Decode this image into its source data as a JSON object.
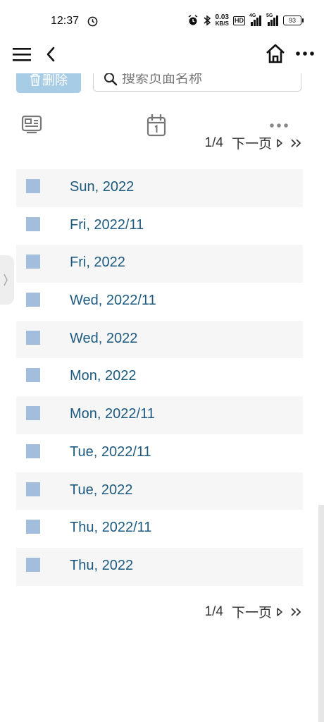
{
  "status_bar": {
    "time": "12:37",
    "net_speed_value": "0.03",
    "net_speed_unit": "KB/S",
    "hd_badge": "HD",
    "signal_1": "4G",
    "signal_2": "5G",
    "battery": "93"
  },
  "toolbar": {
    "delete_label": "删除",
    "search_placeholder": "搜索页面名称"
  },
  "pager_top": {
    "page": "1/4",
    "next_label": "下一页"
  },
  "pager_bottom": {
    "page": "1/4",
    "next_label": "下一页"
  },
  "pages": [
    {
      "label": "Sun, 2022"
    },
    {
      "label": "Fri, 2022/11"
    },
    {
      "label": "Fri, 2022"
    },
    {
      "label": "Wed, 2022/11"
    },
    {
      "label": "Wed, 2022"
    },
    {
      "label": "Mon, 2022"
    },
    {
      "label": "Mon, 2022/11"
    },
    {
      "label": "Tue, 2022/11"
    },
    {
      "label": "Tue, 2022"
    },
    {
      "label": "Thu, 2022/11"
    },
    {
      "label": "Thu, 2022"
    }
  ],
  "colors": {
    "accent_button": "#a7cde6",
    "link_text": "#1d5a80",
    "checkbox": "#a3bedc",
    "row_stripe": "#f6f6f6"
  },
  "icons": [
    "clock-icon",
    "alarm-icon",
    "bluetooth-icon",
    "menu-icon",
    "back-icon",
    "home-icon",
    "more-icon",
    "trash-icon",
    "search-icon",
    "layout-icon",
    "calendar-icon",
    "chevron-right-icon"
  ]
}
